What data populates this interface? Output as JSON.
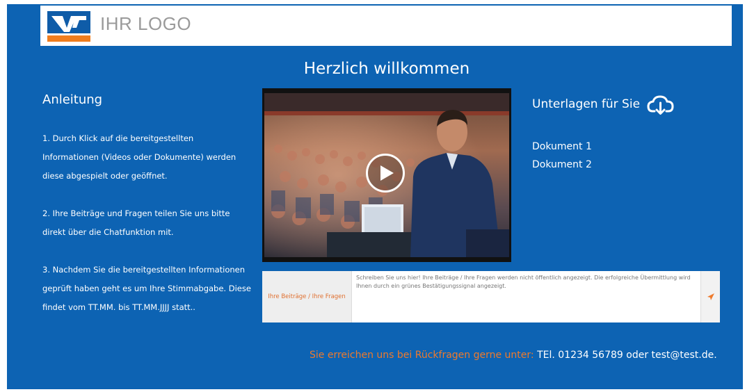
{
  "header": {
    "logo_text": "IHR LOGO"
  },
  "page_title": "Herzlich willkommen",
  "instructions": {
    "title": "Anleitung",
    "steps": [
      "1. Durch Klick auf die bereitgestellten Informationen (Videos oder Dokumente) werden diese abgespielt oder geöffnet.",
      "2. Ihre Beiträge und Fragen teilen Sie uns bitte direkt über die Chatfunktion mit.",
      "3. Nachdem Sie die bereitgestellten Informationen geprüft haben geht es um Ihre Stimmabgabe. Diese findet vom TT.MM. bis TT.MM.JJJJ statt.."
    ]
  },
  "video": {
    "play_icon": "play-icon"
  },
  "documents": {
    "title": "Unterlagen für Sie",
    "icon": "cloud-download-icon",
    "items": [
      "Dokument 1",
      "Dokument 2"
    ]
  },
  "chat": {
    "label": "Ihre Beiträge / Ihre Fragen",
    "placeholder": "Schreiben Sie uns hier! Ihre Beiträge / Ihre Fragen werden nicht öffentlich angezeigt. Die erfolgreiche Übermittlung wird Ihnen durch ein grünes Bestätigungssignal angezeigt.",
    "send_icon": "send-icon"
  },
  "contact": {
    "lead": "Sie erreichen uns bei Rückfragen gerne unter:",
    "info": "TEl. 01234 56789 oder test@test.de."
  },
  "colors": {
    "background": "#0d63b3",
    "accent": "#ee7a2c"
  }
}
